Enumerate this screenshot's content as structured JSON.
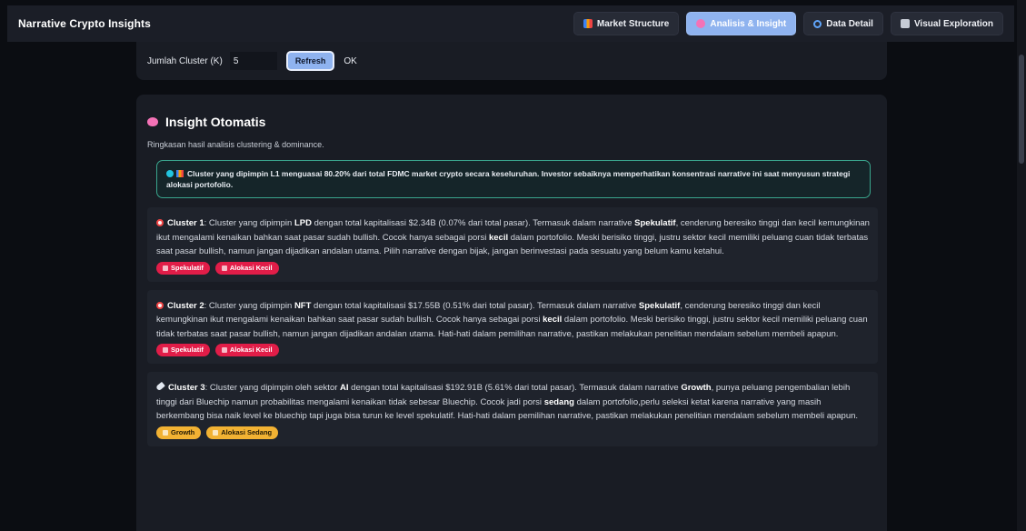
{
  "app": {
    "title": "Narrative Crypto Insights"
  },
  "nav": [
    {
      "label": "Market Structure",
      "icon": "bar-chart-icon",
      "active": false
    },
    {
      "label": "Analisis & Insight",
      "icon": "brain-icon",
      "active": true
    },
    {
      "label": "Data Detail",
      "icon": "search-icon",
      "active": false
    },
    {
      "label": "Visual Exploration",
      "icon": "chart-icon",
      "active": false
    }
  ],
  "controls": {
    "k_label": "Jumlah Cluster (K)",
    "k_value": "5",
    "refresh_label": "Refresh",
    "status": "OK"
  },
  "insight": {
    "title": "Insight Otomatis",
    "subtitle": "Ringkasan hasil analisis clustering & dominance.",
    "summary": {
      "lead": "Cluster yang dipimpin ",
      "leader": "L1",
      "mid": " menguasai ",
      "percent": "80.20%",
      "tail": " dari total FDMC market crypto secara keseluruhan. Investor sebaiknya memperhatikan konsentrasi narrative ini saat menyusun strategi alokasi portofolio."
    },
    "clusters": [
      {
        "name": "Cluster 1",
        "pre": ": Cluster yang dipimpin ",
        "leader": "LPD",
        "cap_text": " dengan total kapitalisasi $2.34B (0.07% dari total pasar). Termasuk dalam narrative ",
        "narrative": "Spekulatif",
        "desc1": ", cenderung beresiko tinggi dan kecil kemungkinan ikut mengalami kenaikan bahkan saat pasar sudah bullish. Cocok hanya sebagai porsi ",
        "alloc": "kecil",
        "desc2": " dalam portofolio. Meski berisiko tinggi, justru sektor kecil memiliki peluang cuan tidak terbatas saat pasar bullish, namun jangan dijadikan andalan utama. Pilih narrative dengan bijak, jangan berinvestasi pada sesuatu yang belum kamu ketahui.",
        "badge1": "Spekulatif",
        "badge2": "Alokasi Kecil"
      },
      {
        "name": "Cluster 2",
        "pre": ": Cluster yang dipimpin ",
        "leader": "NFT",
        "cap_text": " dengan total kapitalisasi $17.55B (0.51% dari total pasar). Termasuk dalam narrative ",
        "narrative": "Spekulatif",
        "desc1": ", cenderung beresiko tinggi dan kecil kemungkinan ikut mengalami kenaikan bahkan saat pasar sudah bullish. Cocok hanya sebagai porsi ",
        "alloc": "kecil",
        "desc2": " dalam portofolio. Meski berisiko tinggi, justru sektor kecil memiliki peluang cuan tidak terbatas saat pasar bullish, namun jangan dijadikan andalan utama. Hati-hati dalam pemilihan narrative, pastikan melakukan penelitian mendalam sebelum membeli apapun.",
        "badge1": "Spekulatif",
        "badge2": "Alokasi Kecil"
      },
      {
        "name": "Cluster 3",
        "pre": ": Cluster yang dipimpin oleh sektor ",
        "leader": "AI",
        "cap_text": " dengan total kapitalisasi $192.91B (5.61% dari total pasar). Termasuk dalam narrative ",
        "narrative": "Growth",
        "desc1": ", punya peluang pengembalian lebih tinggi dari Bluechip namun probabilitas mengalami kenaikan tidak sebesar Bluechip. Cocok jadi porsi ",
        "alloc": "sedang",
        "desc2": " dalam portofolio,perlu seleksi ketat karena narrative yang masih berkembang bisa naik level ke bluechip tapi juga bisa turun ke level spekulatif. Hati-hati dalam pemilihan narrative, pastikan melakukan penelitian mendalam sebelum membeli apapun.",
        "badge1": "Growth",
        "badge2": "Alokasi Sedang"
      }
    ]
  },
  "colors": {
    "accent": "#8fb3ef",
    "summary_border": "#3aa58d",
    "badge_red": "#e11d48",
    "badge_amber": "#f2b233"
  }
}
